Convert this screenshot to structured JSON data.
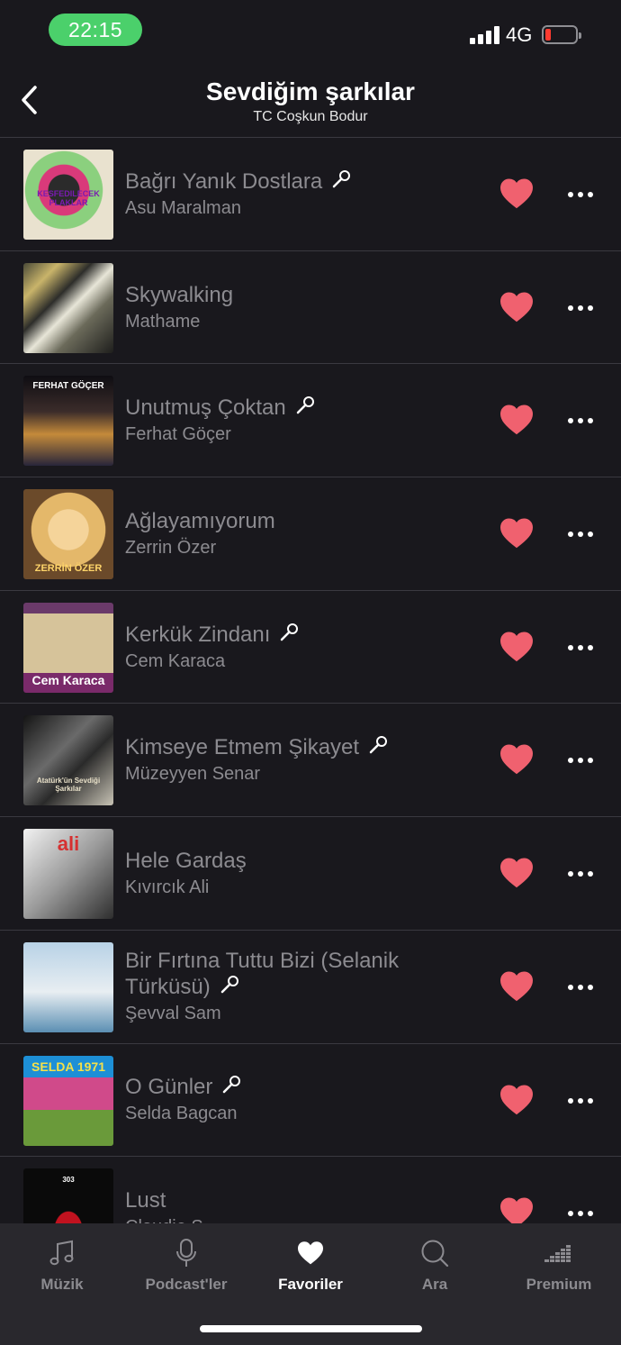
{
  "status_bar": {
    "time": "22:15",
    "network": "4G",
    "battery_level": 0.18,
    "battery_color": "#ff3b30",
    "time_pill_color": "#4bd06b"
  },
  "header": {
    "title": "Sevdiğim şarkılar",
    "subtitle": "TC Coşkun Bodur"
  },
  "tracks": [
    {
      "title": "Bağrı Yanık Dostlara",
      "artist": "Asu Maralman",
      "lyrics": true,
      "liked": true,
      "cover_text": "KESFEDILECEK PLAKLAR"
    },
    {
      "title": "Skywalking",
      "artist": "Mathame",
      "lyrics": false,
      "liked": true,
      "cover_text": ""
    },
    {
      "title": "Unutmuş Çoktan",
      "artist": "Ferhat Göçer",
      "lyrics": true,
      "liked": true,
      "cover_text": "FERHAT GÖÇER"
    },
    {
      "title": "Ağlayamıyorum",
      "artist": "Zerrin Özer",
      "lyrics": false,
      "liked": true,
      "cover_text": "ZERRİN ÖZER"
    },
    {
      "title": "Kerkük Zindanı",
      "artist": "Cem Karaca",
      "lyrics": true,
      "liked": true,
      "cover_text": "Cem Karaca"
    },
    {
      "title": "Kimseye Etmem Şikayet",
      "artist": "Müzeyyen Senar",
      "lyrics": true,
      "liked": true,
      "cover_text": "Atatürk'ün Sevdiği Şarkılar"
    },
    {
      "title": "Hele Gardaş",
      "artist": "Kıvırcık Ali",
      "lyrics": false,
      "liked": true,
      "cover_text": "ali"
    },
    {
      "title": "Bir Fırtına Tuttu Bizi (Selanik Türküsü)",
      "artist": "Şevval Sam",
      "lyrics": true,
      "liked": true,
      "cover_text": ""
    },
    {
      "title": "O Günler",
      "artist": "Selda Bagcan",
      "lyrics": true,
      "liked": true,
      "cover_text": "SELDA 1971"
    },
    {
      "title": "Lust",
      "artist": "Claudio S",
      "lyrics": false,
      "liked": true,
      "cover_text": "303"
    }
  ],
  "tabs": [
    {
      "label": "Müzik",
      "icon": "music-note-icon",
      "active": false
    },
    {
      "label": "Podcast'ler",
      "icon": "microphone-icon",
      "active": false
    },
    {
      "label": "Favoriler",
      "icon": "heart-icon",
      "active": true
    },
    {
      "label": "Ara",
      "icon": "search-icon",
      "active": false
    },
    {
      "label": "Premium",
      "icon": "equalizer-icon",
      "active": false
    }
  ],
  "colors": {
    "background": "#19181d",
    "tab_bar": "#29282d",
    "heart": "#f0616f",
    "muted_text": "#8c8b90",
    "divider": "#3a3940"
  }
}
